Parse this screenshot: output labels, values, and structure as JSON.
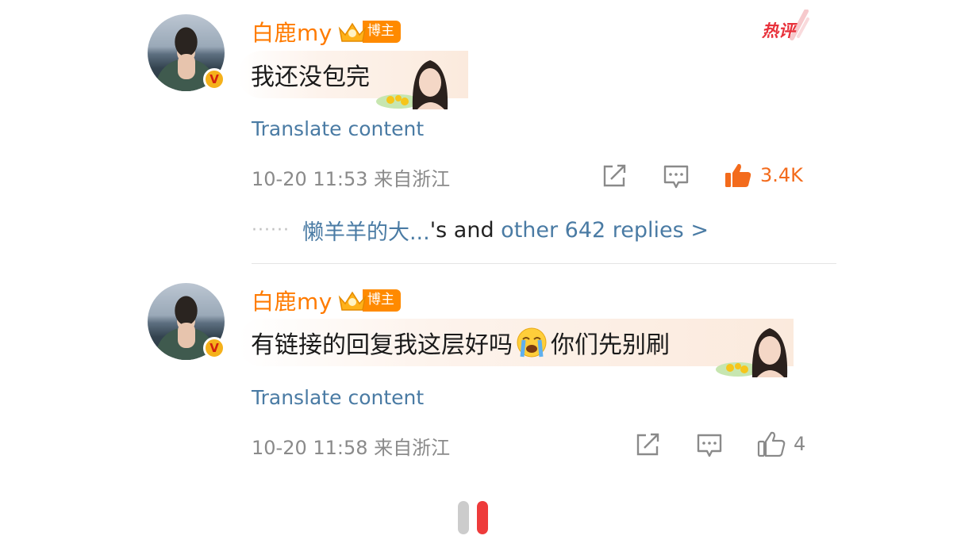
{
  "comments": [
    {
      "username": "白鹿my",
      "role_badge": "博主",
      "verified_mark": "V",
      "content": "我还没包完",
      "translate_label": "Translate content",
      "time": "10-20 11:53 来自浙江",
      "like_count": "3.4K",
      "liked": true,
      "hot_badge": "热评",
      "replies": {
        "dots": "······",
        "first_user": "懒羊羊的大...",
        "middle": "'s and ",
        "other": "other 642 replies >"
      }
    },
    {
      "username": "白鹿my",
      "role_badge": "博主",
      "verified_mark": "V",
      "content_before": "有链接的回复我这层好吗",
      "content_emoji": "crying-face-emoji",
      "content_after": "你们先别刷",
      "translate_label": "Translate content",
      "time": "10-20 11:58 来自浙江",
      "like_count": "4",
      "liked": false
    }
  ],
  "colors": {
    "username": "#ff7b00",
    "link_blue": "#4a7ba4",
    "like_active": "#f36b1c",
    "icon_gray": "#8a8a8a",
    "hot_red": "#e8313b",
    "pager_active": "#ee3b3b",
    "pager_inactive": "#cccccc"
  },
  "icons": [
    "crown-icon",
    "verified-badge-icon",
    "hot-comment-icon",
    "share-icon",
    "comment-icon",
    "like-icon",
    "crying-face-emoji"
  ],
  "pager": {
    "count": 2,
    "active_index": 1
  }
}
